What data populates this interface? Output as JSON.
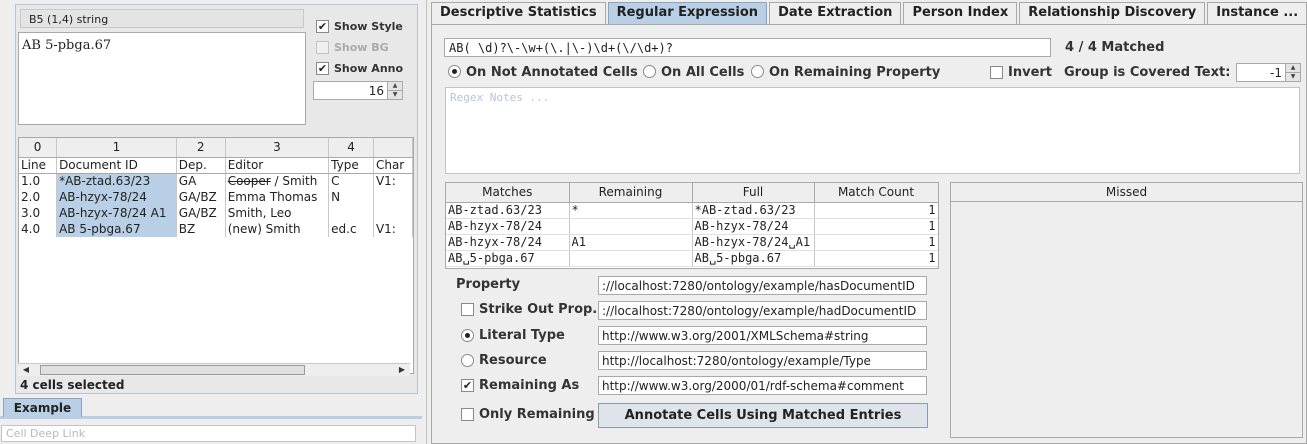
{
  "left": {
    "cell_address": "B5 (1,4) string",
    "cell_value": "AB 5-pbga.67",
    "show_style_label": "Show Style",
    "show_bg_label": "Show BG",
    "show_anno_label": "Show Anno",
    "spinner_value": "16",
    "grid": {
      "col_numbers": [
        "0",
        "1",
        "2",
        "3",
        "4",
        ""
      ],
      "headers": [
        "Line",
        "Document ID",
        "Dep.",
        "Editor",
        "Type",
        "Char"
      ],
      "rows": [
        {
          "line": "1.0",
          "doc": "*AB-ztad.63/23",
          "dep": "GA",
          "editor_strike": "Cooper",
          "editor_rest": " / Smith",
          "type": "C",
          "char": "V1:"
        },
        {
          "line": "2.0",
          "doc": "AB-hzyx-78/24",
          "dep": "GA/BZ",
          "editor_strike": "",
          "editor_rest": "Emma Thomas",
          "type": "N",
          "char": ""
        },
        {
          "line": "3.0",
          "doc": "AB-hzyx-78/24 A1",
          "dep": "GA/BZ",
          "editor_strike": "",
          "editor_rest": "Smith, Leo",
          "type": "",
          "char": ""
        },
        {
          "line": "4.0",
          "doc": "AB 5-pbga.67",
          "dep": "BZ",
          "editor_strike": "",
          "editor_rest": "(new) Smith",
          "type": "ed.c",
          "char": "V1:"
        }
      ]
    },
    "status": "4 cells selected",
    "tab_example": "Example",
    "deep_link_placeholder": "Cell Deep Link"
  },
  "tabs": [
    "Descriptive Statistics",
    "Regular Expression",
    "Date Extraction",
    "Person Index",
    "Relationship Discovery",
    "Instance ..."
  ],
  "regex": {
    "pattern": "AB( \\d)?\\-\\w+(\\.|\\-)\\d+(\\/\\d+)?",
    "matched": "4 / 4 Matched",
    "opt_not_annotated": "On Not Annotated Cells",
    "opt_all": "On All Cells",
    "opt_remaining": "On Remaining Property",
    "invert_label": "Invert",
    "group_label": "Group is Covered Text:",
    "group_value": "-1",
    "notes_placeholder": "Regex Notes ..."
  },
  "matches": {
    "headers": [
      "Matches",
      "Remaining",
      "Full",
      "Match Count"
    ],
    "rows": [
      {
        "match": "AB-ztad.63/23",
        "remaining": "*",
        "full": "*AB-ztad.63/23",
        "count": "1"
      },
      {
        "match": "AB-hzyx-78/24",
        "remaining": "",
        "full": "AB-hzyx-78/24",
        "count": "1"
      },
      {
        "match": "AB-hzyx-78/24",
        "remaining": "A1",
        "full": "AB-hzyx-78/24␣A1",
        "count": "1"
      },
      {
        "match": "AB␣5-pbga.67",
        "remaining": "",
        "full": "AB␣5-pbga.67",
        "count": "1"
      }
    ],
    "missed_header": "Missed"
  },
  "form": {
    "property_label": "Property",
    "property_value": "://localhost:7280/ontology/example/hasDocumentID",
    "strike_label": "Strike Out Prop.",
    "strike_value": "://localhost:7280/ontology/example/hadDocumentID",
    "literal_label": "Literal Type",
    "literal_value": "http://www.w3.org/2001/XMLSchema#string",
    "resource_label": "Resource",
    "resource_value": "http://localhost:7280/ontology/example/Type",
    "remaining_label": "Remaining As",
    "remaining_value": "http://www.w3.org/2000/01/rdf-schema#comment",
    "only_remaining_label": "Only Remaining",
    "annotate_button": "Annotate Cells Using Matched Entries"
  }
}
